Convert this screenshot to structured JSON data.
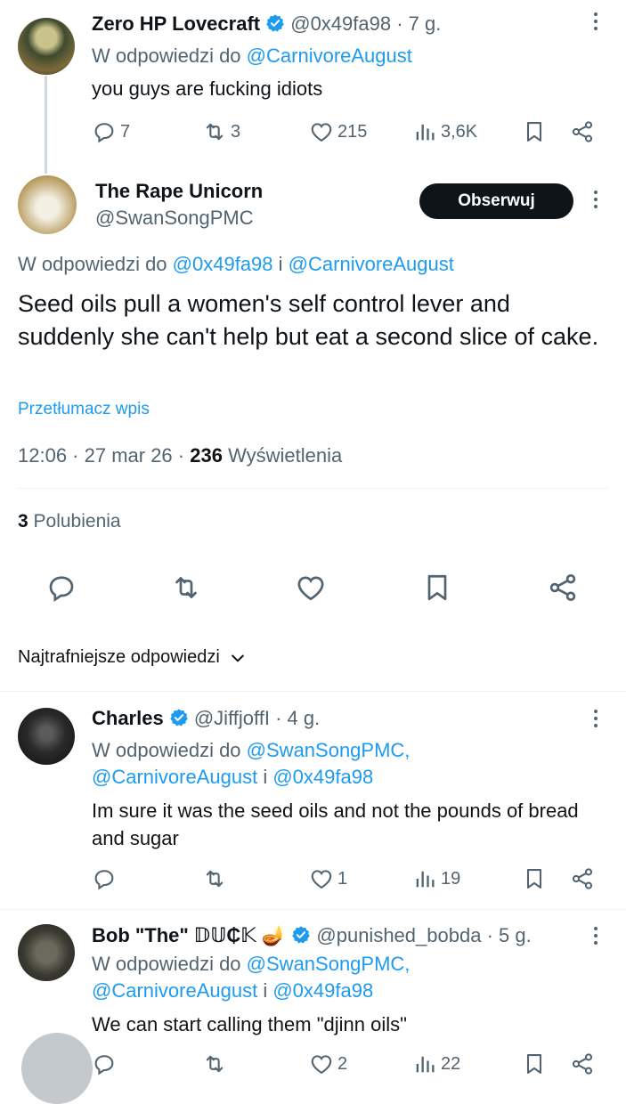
{
  "reply_top": {
    "name": "Zero HP Lovecraft",
    "handle": "@0x49fa98",
    "time": "· 7 g.",
    "reply_prefix": "W odpowiedzi do",
    "reply_to": "@CarnivoreAugust",
    "text": "you guys are fucking idiots",
    "stats": {
      "replies": "7",
      "reposts": "3",
      "likes": "215",
      "views": "3,6K"
    }
  },
  "main_tweet": {
    "name": "The Rape Unicorn",
    "handle": "@SwanSongPMC",
    "follow_label": "Obserwuj",
    "reply_prefix": "W odpowiedzi do",
    "reply_to_1": "@0x49fa98",
    "reply_join": "i",
    "reply_to_2": "@CarnivoreAugust",
    "text": "Seed oils pull a women's self control lever and suddenly she can't help but eat a second slice of cake.",
    "translate": "Przetłumacz wpis",
    "timestamp": "12:06 · 27 mar 26 ·",
    "views_count": "236",
    "views_label": "Wyświetlenia",
    "likes_count": "3",
    "likes_label": "Polubienia"
  },
  "sort": {
    "label": "Najtrafniejsze odpowiedzi"
  },
  "replies": [
    {
      "name": "Charles",
      "handle": "@JiffjoffI",
      "time": "· 4 g.",
      "reply_prefix": "W odpowiedzi do",
      "reply_to_line1": "@SwanSongPMC,",
      "reply_to_line2a": "@CarnivoreAugust",
      "reply_join": "i",
      "reply_to_line2b": "@0x49fa98",
      "text": "Im sure it was the seed oils and not the pounds of bread and sugar",
      "stats": {
        "likes": "1",
        "views": "19"
      }
    },
    {
      "name": "Bob \"The\" 𝔻𝕌₵𝕂",
      "emoji": "🪔",
      "handle": "@punished_bobda",
      "time": "· 5 g.",
      "reply_prefix": "W odpowiedzi do",
      "reply_to_line1": "@SwanSongPMC,",
      "reply_to_line2a": "@CarnivoreAugust",
      "reply_join": "i",
      "reply_to_line2b": "@0x49fa98",
      "text": "We can start calling them \"djinn oils\"",
      "stats": {
        "likes": "2",
        "views": "22"
      }
    }
  ],
  "colors": {
    "link": "#1d9bf0",
    "muted": "#536471",
    "text": "#0f1419",
    "verified": "#1d9bf0"
  }
}
